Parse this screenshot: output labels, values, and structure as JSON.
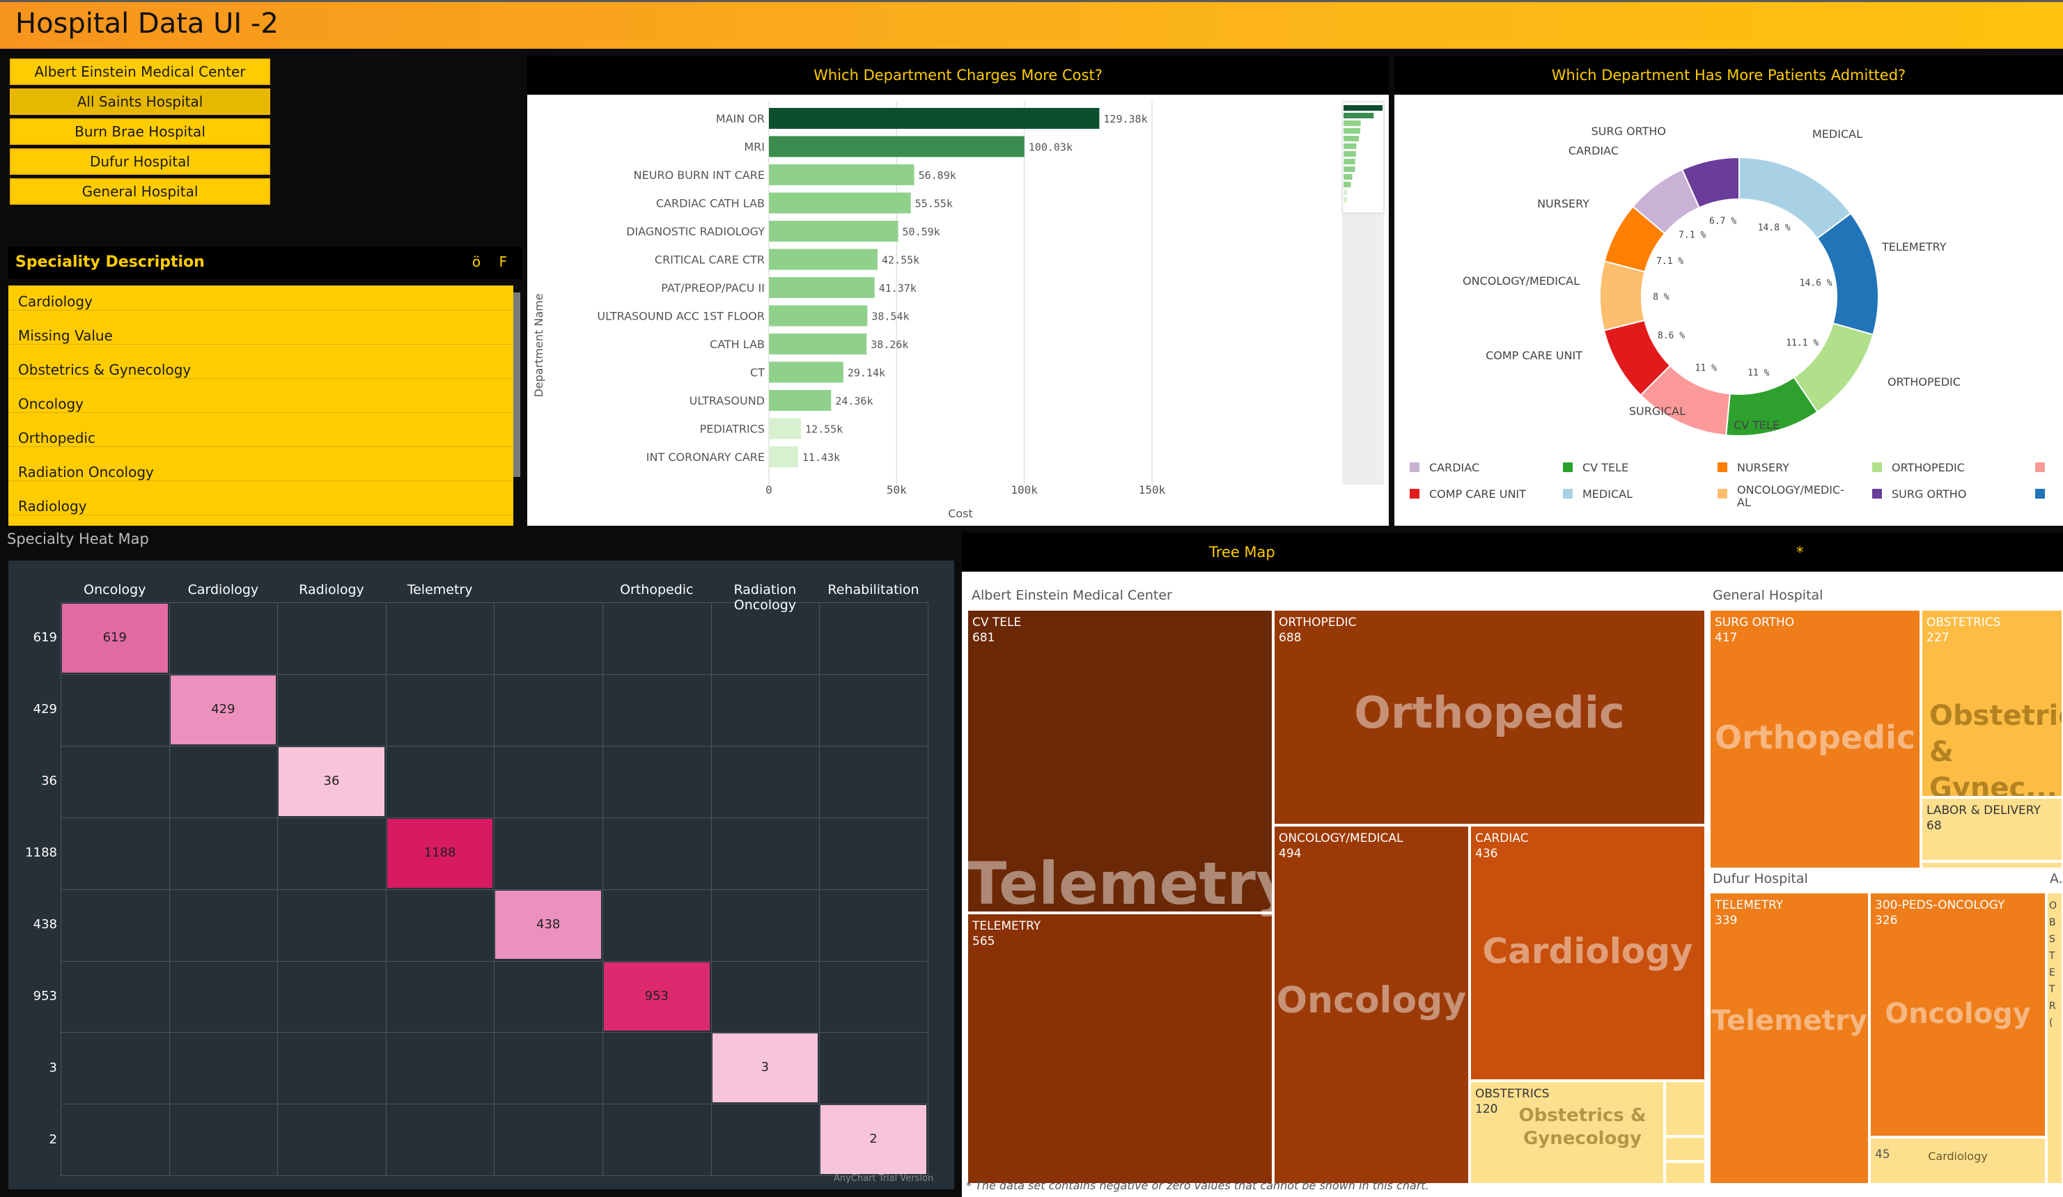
{
  "app": {
    "title": "Hospital Data UI -2"
  },
  "hospitals": [
    {
      "label": "Albert Einstein Medical Center"
    },
    {
      "label": "All Saints Hospital"
    },
    {
      "label": "Burn Brae Hospital"
    },
    {
      "label": "Dufur Hospital"
    },
    {
      "label": "General Hospital"
    }
  ],
  "speciality": {
    "title": "Speciality Description",
    "icons": "ö F",
    "items": [
      "Cardiology",
      "Missing Value",
      "Obstetrics & Gynecology",
      "Oncology",
      "Orthopedic",
      "Radiation Oncology",
      "Radiology"
    ]
  },
  "cost_chart": {
    "title": "Which Department Charges More Cost?",
    "ylabel": "Department Name",
    "xlabel": "Cost",
    "xticks": [
      "0",
      "50k",
      "100k",
      "150k"
    ],
    "colors": {
      "dark": "#0b4f2e",
      "mid": "#3a8c4f",
      "light": "#8fd18b",
      "pale": "#d7f0cf"
    }
  },
  "chart_data": [
    {
      "type": "bar",
      "title": "Which Department Charges More Cost?",
      "xlabel": "Cost",
      "ylabel": "Department Name",
      "xlim": [
        0,
        150000
      ],
      "categories": [
        "MAIN OR",
        "MRI",
        "NEURO BURN INT CARE",
        "CARDIAC CATH LAB",
        "DIAGNOSTIC RADIOLOGY",
        "CRITICAL CARE CTR",
        "PAT/PREOP/PACU II",
        "ULTRASOUND ACC 1ST FLOOR",
        "CATH LAB",
        "CT",
        "ULTRASOUND",
        "PEDIATRICS",
        "INT CORONARY CARE"
      ],
      "values": [
        129380,
        100030,
        56890,
        55550,
        50590,
        42550,
        41370,
        38540,
        38260,
        29140,
        24360,
        12550,
        11430
      ],
      "labels": [
        "129.38k",
        "100.03k",
        "56.89k",
        "55.55k",
        "50.59k",
        "42.55k",
        "41.37k",
        "38.54k",
        "38.26k",
        "29.14k",
        "24.36k",
        "12.55k",
        "11.43k"
      ]
    },
    {
      "type": "pie",
      "title": "Which Department Has More Patients Admitted?",
      "slices": [
        {
          "name": "MEDICAL",
          "value": 14.8,
          "label": "14.8 %",
          "color": "#a9d1e6"
        },
        {
          "name": "TELEMETRY",
          "value": 14.6,
          "label": "14.6 %",
          "color": "#2274b8"
        },
        {
          "name": "ORTHOPEDIC",
          "value": 11.1,
          "label": "11.1 %",
          "color": "#b0e08a"
        },
        {
          "name": "CV TELE",
          "value": 11.0,
          "label": "11 %",
          "color": "#2ea02e"
        },
        {
          "name": "SURGICAL",
          "value": 11.0,
          "label": "11 %",
          "color": "#fb9a99"
        },
        {
          "name": "COMP CARE UNIT",
          "value": 8.6,
          "label": "8.6 %",
          "color": "#e31a1c"
        },
        {
          "name": "ONCOLOGY/MEDICAL",
          "value": 8.0,
          "label": "8 %",
          "color": "#fdbf6f"
        },
        {
          "name": "NURSERY",
          "value": 7.1,
          "label": "7.1 %",
          "color": "#ff7f00"
        },
        {
          "name": "CARDIAC",
          "value": 7.1,
          "label": "7.1 %",
          "color": "#cab2d6"
        },
        {
          "name": "SURG ORTHO",
          "value": 6.7,
          "label": "6.7 %",
          "color": "#6a3d9a"
        }
      ],
      "legend": [
        {
          "name": "CARDIAC",
          "color": "#cab2d6"
        },
        {
          "name": "CV TELE",
          "color": "#2ea02e"
        },
        {
          "name": "NURSERY",
          "color": "#ff7f00"
        },
        {
          "name": "ORTHOPEDIC",
          "color": "#b0e08a"
        },
        {
          "name": "COMP CARE UNIT",
          "color": "#e31a1c"
        },
        {
          "name": "MEDICAL",
          "color": "#a9d1e6"
        },
        {
          "name": "ONCOLOGY/MEDIC-AL",
          "color": "#fdbf6f"
        },
        {
          "name": "SURG ORTHO",
          "color": "#6a3d9a"
        }
      ]
    },
    {
      "type": "heatmap",
      "title": "Specialty Heat Map",
      "columns": [
        "Oncology",
        "Cardiology",
        "Radiology",
        "Telemetry",
        "",
        "Orthopedic",
        "Radiation Oncology",
        "Rehabilitation"
      ],
      "rows": [
        "619",
        "429",
        "36",
        "1188",
        "438",
        "953",
        "3",
        "2"
      ],
      "cells": [
        {
          "row": 0,
          "col": 0,
          "value": 619,
          "color": "#e26ba5"
        },
        {
          "row": 1,
          "col": 1,
          "value": 429,
          "color": "#ec90bd"
        },
        {
          "row": 2,
          "col": 2,
          "value": 36,
          "color": "#f8c4da"
        },
        {
          "row": 3,
          "col": 3,
          "value": 1188,
          "color": "#d81b60"
        },
        {
          "row": 4,
          "col": 4,
          "value": 438,
          "color": "#ec90bd"
        },
        {
          "row": 5,
          "col": 5,
          "value": 953,
          "color": "#dd2a6e"
        },
        {
          "row": 6,
          "col": 6,
          "value": 3,
          "color": "#f8c4da"
        },
        {
          "row": 7,
          "col": 7,
          "value": 2,
          "color": "#f8c4da"
        }
      ]
    }
  ],
  "donut": {
    "title": "Which Department Has More Patients Admitted?"
  },
  "heatmap": {
    "caption": "Specialty Heat Map",
    "watermark": "AnyChart Trial Version"
  },
  "treemap": {
    "title": "Tree Map",
    "star": "*",
    "note": "* The data set contains negative or zero values that cannot be shown in this chart.",
    "groups": {
      "einstein": "Albert Einstein Medical Center",
      "general": "General Hospital",
      "dufur": "Dufur Hospital",
      "other": "A..."
    },
    "tiles": {
      "cv_tele": {
        "name": "CV TELE",
        "value": "681"
      },
      "telemetry_ae": {
        "name": "TELEMETRY",
        "value": "565"
      },
      "telemetry_ae_big": "Telemetry",
      "orthopedic_ae": {
        "name": "ORTHOPEDIC",
        "value": "688",
        "big": "Orthopedic"
      },
      "oncology_ae": {
        "name": "ONCOLOGY/MEDICAL",
        "value": "494",
        "big": "Oncology"
      },
      "cardiac_ae": {
        "name": "CARDIAC",
        "value": "436",
        "big": "Cardiology"
      },
      "obstetrics_ae": {
        "name": "OBSTETRICS",
        "value": "120",
        "big": "Obstetrics & Gynecology"
      },
      "surg_ortho_gh": {
        "name": "SURG ORTHO",
        "value": "417",
        "big": "Orthopedic"
      },
      "obstetrics_gh": {
        "name": "OBSTETRICS",
        "value": "227",
        "big": "Obstetrics & Gynec..."
      },
      "labor_gh": {
        "name": "LABOR & DELIVERY",
        "value": "68"
      },
      "telemetry_dh": {
        "name": "TELEMETRY",
        "value": "339",
        "big": "Telemetry"
      },
      "peds_dh": {
        "name": "300-PEDS-ONCOLOGY",
        "value": "326",
        "big": "Oncology"
      },
      "small_dh": {
        "value": "45",
        "big": "Cardiology"
      },
      "other_letters": "O B S T E T R ("
    }
  }
}
